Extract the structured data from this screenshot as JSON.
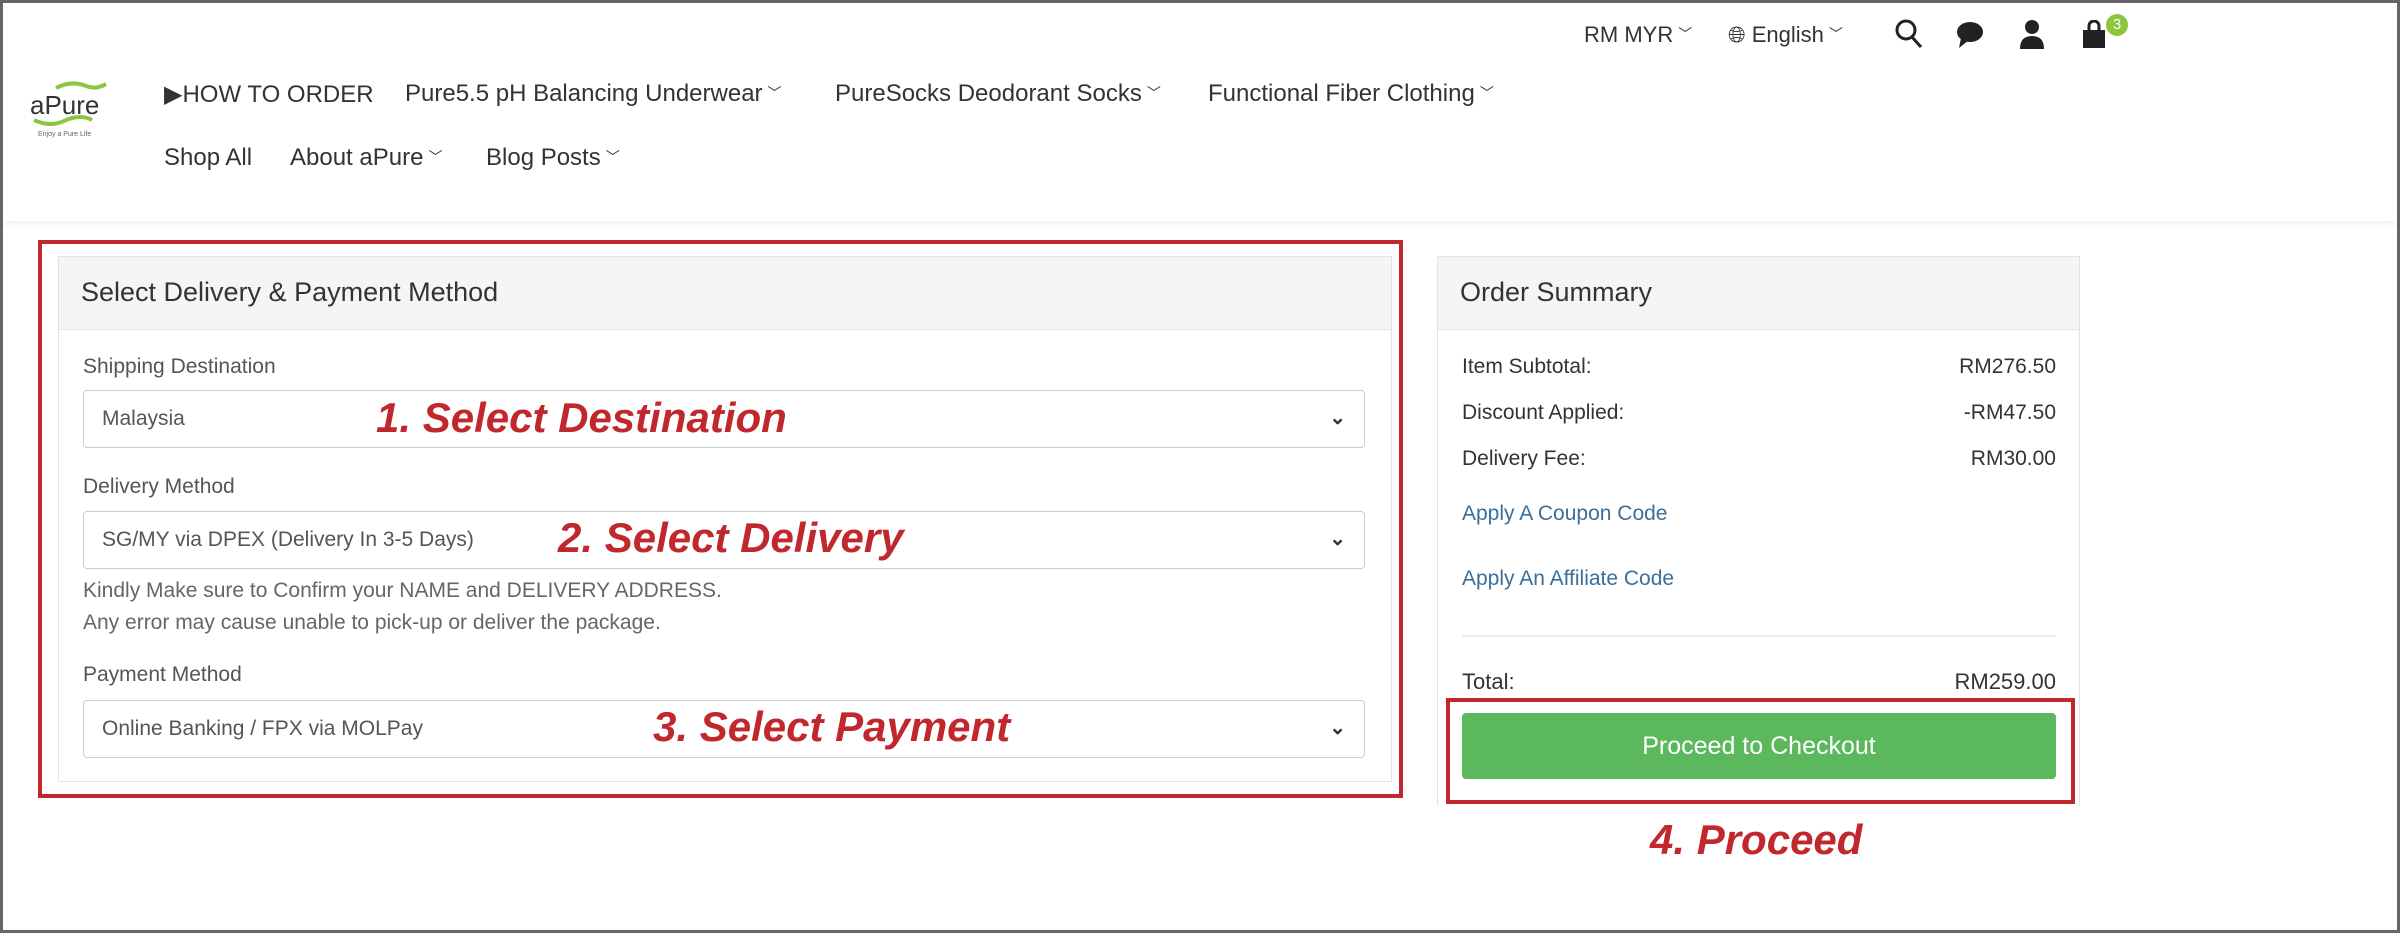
{
  "header": {
    "logo_text": "aPure",
    "logo_tagline": "Enjoy a Pure Life",
    "currency": "RM MYR",
    "language": "English",
    "cart_count": "3",
    "nav": [
      {
        "label": "▶HOW TO ORDER",
        "dropdown": false
      },
      {
        "label": "Pure5.5 pH Balancing Underwear",
        "dropdown": true
      },
      {
        "label": "PureSocks Deodorant Socks",
        "dropdown": true
      },
      {
        "label": "Functional Fiber Clothing",
        "dropdown": true
      },
      {
        "label": "Shop All",
        "dropdown": false
      },
      {
        "label": "About aPure",
        "dropdown": true
      },
      {
        "label": "Blog Posts",
        "dropdown": true
      }
    ]
  },
  "delivery_panel": {
    "title": "Select Delivery & Payment Method",
    "shipping_label": "Shipping Destination",
    "shipping_value": "Malaysia",
    "delivery_label": "Delivery Method",
    "delivery_value": "SG/MY via DPEX (Delivery In 3-5 Days)",
    "note_line1": "Kindly Make sure to Confirm your NAME and DELIVERY ADDRESS.",
    "note_line2": "Any error may cause unable to pick-up or deliver the package.",
    "payment_label": "Payment Method",
    "payment_value": "Online Banking / FPX via MOLPay"
  },
  "summary": {
    "title": "Order Summary",
    "rows": [
      {
        "label": "Item Subtotal:",
        "value": "RM276.50"
      },
      {
        "label": "Discount Applied:",
        "value": "-RM47.50"
      },
      {
        "label": "Delivery Fee:",
        "value": "RM30.00"
      }
    ],
    "coupon_link": "Apply A Coupon Code",
    "affiliate_link": "Apply An Affiliate Code",
    "total_label": "Total:",
    "total_value": "RM259.00",
    "checkout_button": "Proceed to Checkout"
  },
  "annotations": {
    "step1": "1. Select Destination",
    "step2": "2. Select Delivery",
    "step3": "3. Select Payment",
    "step4": "4. Proceed"
  },
  "colors": {
    "annotation": "#c0282d",
    "button": "#5cb85c",
    "link": "#3a6f9a",
    "badge": "#8cc63f"
  }
}
